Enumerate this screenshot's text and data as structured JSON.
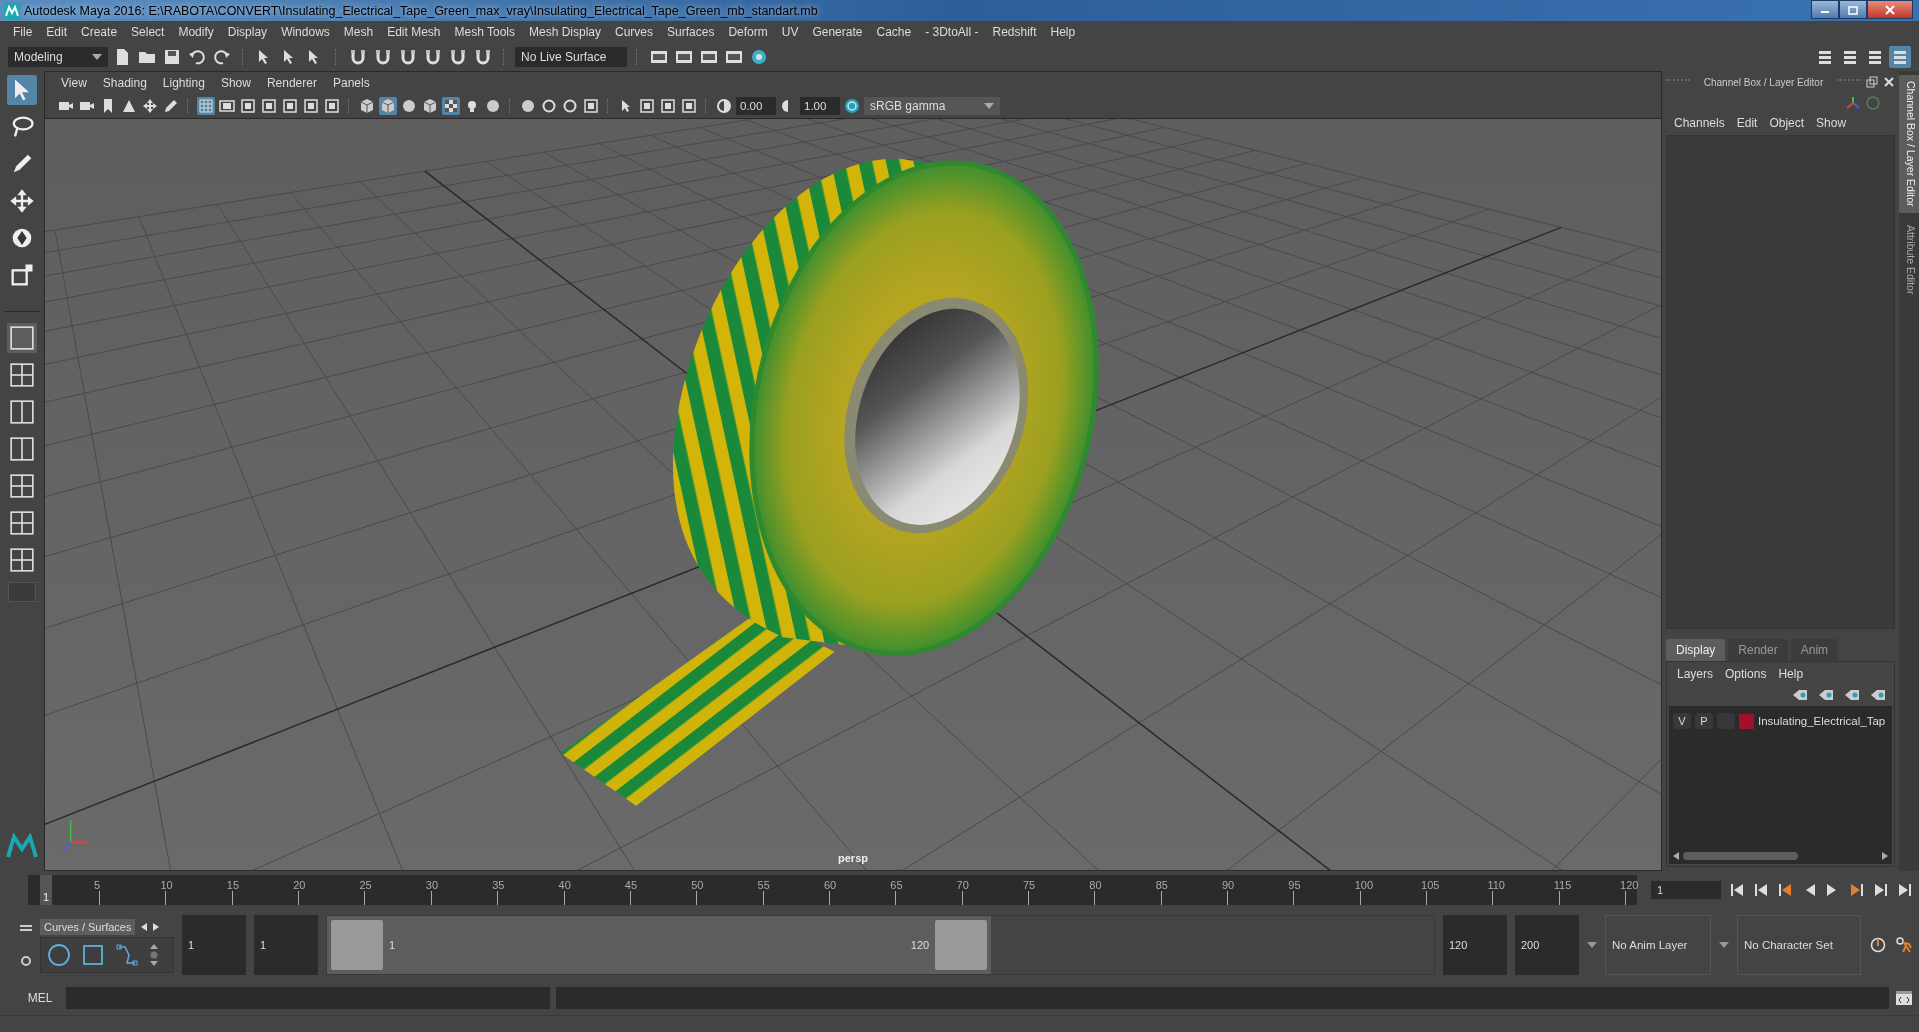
{
  "window": {
    "title": "Autodesk Maya 2016: E:\\RABOTA\\CONVERT\\Insulating_Electrical_Tape_Green_max_vray\\Insulating_Electrical_Tape_Green_mb_standart.mb"
  },
  "menu_bar": [
    "File",
    "Edit",
    "Create",
    "Select",
    "Modify",
    "Display",
    "Windows",
    "Mesh",
    "Edit Mesh",
    "Mesh Tools",
    "Mesh Display",
    "Curves",
    "Surfaces",
    "Deform",
    "UV",
    "Generate",
    "Cache",
    "- 3DtoAll -",
    "Redshift",
    "Help"
  ],
  "status_line": {
    "workspace": "Modeling",
    "live_surface": "No Live Surface"
  },
  "viewport": {
    "menus": [
      "View",
      "Shading",
      "Lighting",
      "Show",
      "Renderer",
      "Panels"
    ],
    "exposure": "0.00",
    "gamma": "1.00",
    "color_space": "sRGB gamma",
    "camera": "persp"
  },
  "channel_box": {
    "title": "Channel Box / Layer Editor",
    "menus": [
      "Channels",
      "Edit",
      "Object",
      "Show"
    ]
  },
  "side_tabs": [
    {
      "label": "Channel Box / Layer Editor",
      "selected": true
    },
    {
      "label": "Attribute Editor",
      "selected": false
    }
  ],
  "layer_editor": {
    "tabs": [
      {
        "label": "Display",
        "selected": true
      },
      {
        "label": "Render",
        "selected": false
      },
      {
        "label": "Anim",
        "selected": false
      }
    ],
    "menus": [
      "Layers",
      "Options",
      "Help"
    ],
    "layers": [
      {
        "visible": "V",
        "playback": "P",
        "name": "Insulating_Electrical_Tap",
        "color": "#a3102c"
      }
    ]
  },
  "time_slider": {
    "current_frame": "1",
    "level": 0,
    "ticks": [
      "5",
      "10",
      "15",
      "20",
      "25",
      "30",
      "35",
      "40",
      "45",
      "50",
      "55",
      "60",
      "65",
      "70",
      "75",
      "80",
      "85",
      "90",
      "95",
      "100",
      "105",
      "110",
      "115",
      "120"
    ],
    "frame_field": "1"
  },
  "range_slider": {
    "shelf_tab": "Curves / Surfaces",
    "start_time": "1",
    "playback_start": "1",
    "range_start": "1",
    "range_end": "120",
    "level": 0.6,
    "playback_end": "120",
    "end_time": "200",
    "anim_layer": "No Anim Layer",
    "character_set": "No Character Set"
  },
  "command_line": {
    "label": "MEL"
  }
}
